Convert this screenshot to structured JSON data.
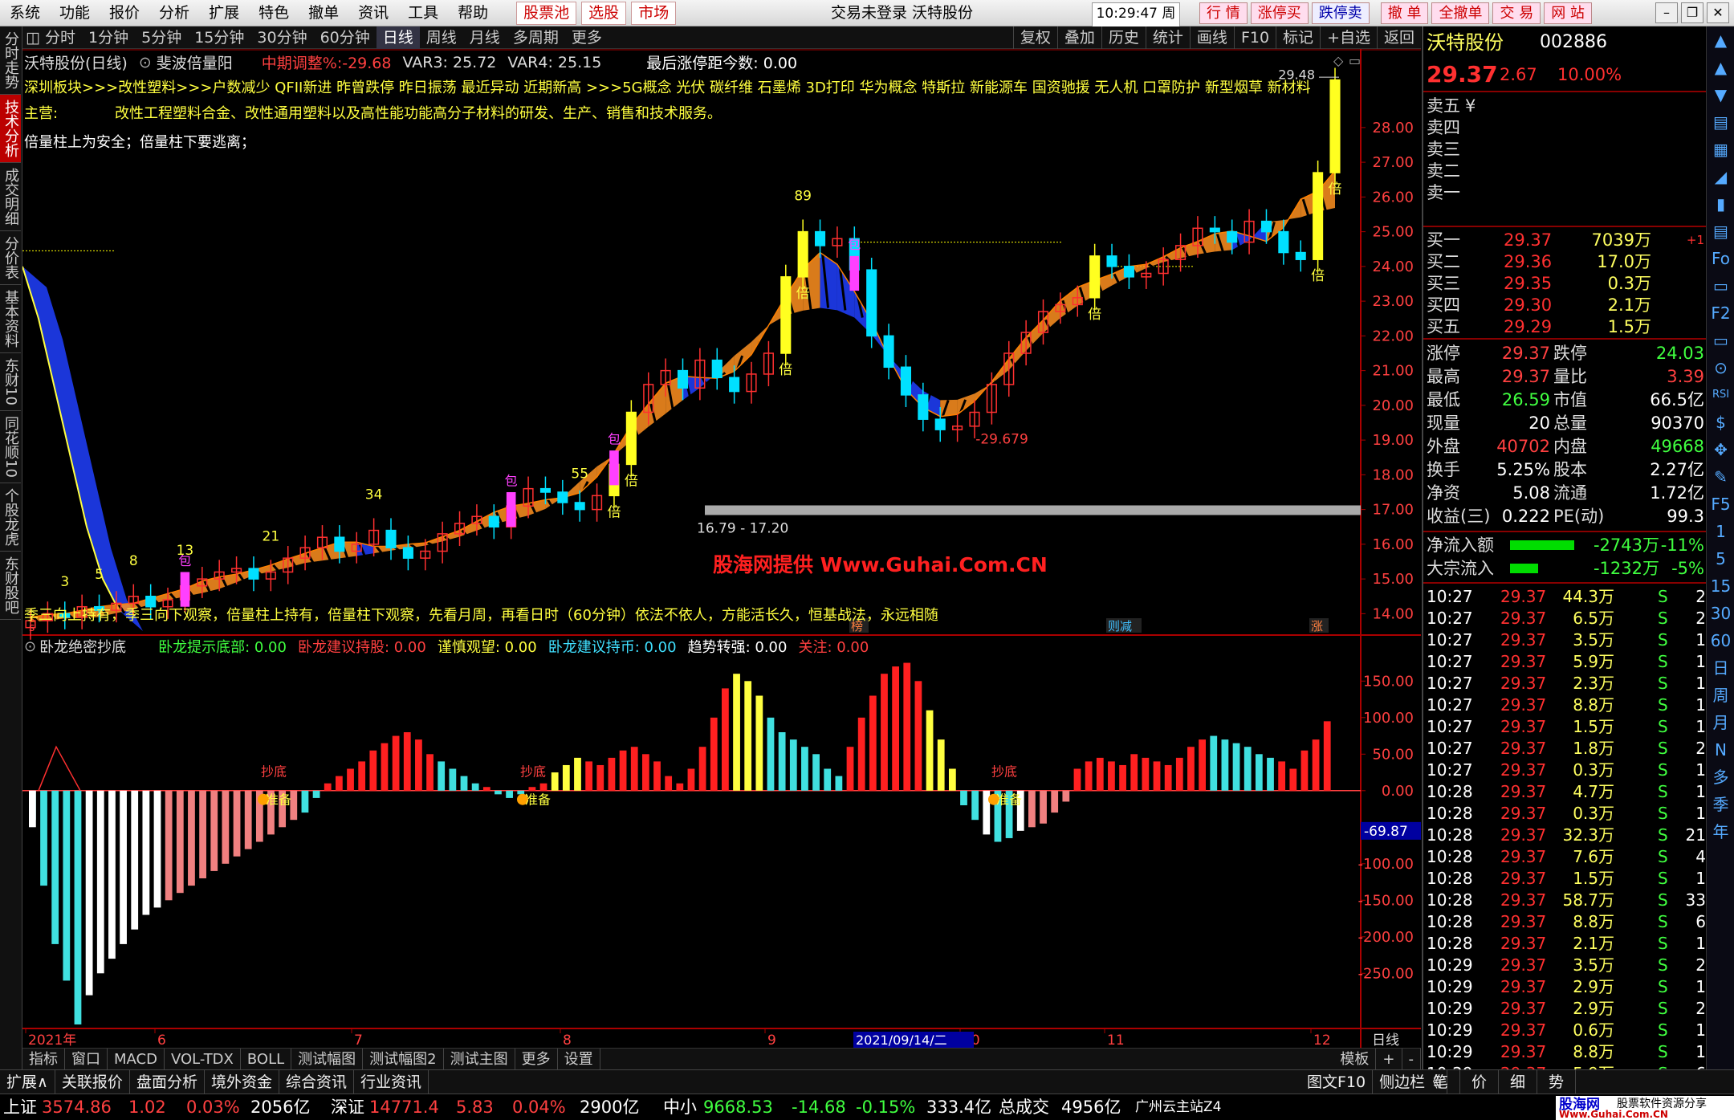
{
  "menubar": {
    "items": [
      "系统",
      "功能",
      "报价",
      "分析",
      "扩展",
      "特色",
      "撤单",
      "资讯",
      "工具",
      "帮助"
    ],
    "red_items": [
      "股票池",
      "选股",
      "市场"
    ],
    "center_title": "交易未登录  沃特股份",
    "time": "10:29:47 周五",
    "right_buttons": [
      "行 情",
      "涨停买",
      "跌停卖",
      "撤 单",
      "全撤单",
      "交 易",
      "网 站"
    ]
  },
  "leftbar": [
    "分时走势",
    "技术分析",
    "成交明细",
    "分价表",
    "基本资料",
    "东财10",
    "同花顺10",
    "个股龙虎",
    "东财股吧"
  ],
  "periodbar": {
    "items": [
      "分时",
      "1分钟",
      "5分钟",
      "15分钟",
      "30分钟",
      "60分钟",
      "日线",
      "周线",
      "月线",
      "多周期",
      "更多"
    ],
    "active": "日线",
    "right": [
      "复权",
      "叠加",
      "历史",
      "统计",
      "画线",
      "F10",
      "标记",
      "+自选",
      "返回"
    ]
  },
  "main_chart": {
    "stock_label": "沃特股份(日线)",
    "indicator_name": "斐波倍量阳",
    "indicator_values": [
      {
        "text": "中期调整%:-29.68",
        "color": "#ff4040"
      },
      {
        "text": "VAR3: 25.72",
        "color": "#dddddd"
      },
      {
        "text": "VAR4: 25.15",
        "color": "#dddddd"
      },
      {
        "text": "最后涨停距今数: 0.00",
        "color": "#ffffff"
      }
    ],
    "concept_line": "深圳板块>>>改性塑料>>>户数减少 QFII新进 昨曾跌停 昨日振荡 最近异动 近期新高 >>>5G概念 光伏 碳纤维 石墨烯 3D打印 华为概念 特斯拉 新能源车 国资驰援 无人机 口罩防护 新型烟草 新材料",
    "business_label": "主营:",
    "business_text": "改性工程塑料合金、改性通用塑料以及高性能功能高分子材料的研发、生产、销售和技术服务。",
    "slogan": "倍量柱上为安全；倍量柱下要逃离；",
    "bottom_text": "季三向上持有，季三向下观察，倍量柱上持有，倍量柱下观察，先看月周，再看日时（60分钟）依法不依人，方能活长久，恒基战法，永远相随",
    "watermark": "股海网提供 Www.Guhai.Com.CN",
    "support_band": "16.79 - 17.20",
    "high_label": "29.48",
    "low_label": "-29.679",
    "y_ticks": [
      "28.00",
      "27.00",
      "26.00",
      "25.00",
      "24.00",
      "23.00",
      "22.00",
      "21.00",
      "20.00",
      "19.00",
      "18.00",
      "17.00",
      "16.00",
      "15.00",
      "14.00"
    ],
    "number_labels": [
      "3",
      "5",
      "8",
      "13",
      "21",
      "34",
      "55",
      "89"
    ],
    "bei_label": "倍",
    "bao_label": "包",
    "markers": [
      {
        "text": "榜",
        "color": "#ff8040"
      },
      {
        "text": "则减",
        "color": "#40c0ff"
      },
      {
        "text": "涨",
        "color": "#ff8040"
      }
    ]
  },
  "sub_chart": {
    "name": "卧龙绝密抄底",
    "values": [
      {
        "text": "卧龙提示底部: 0.00",
        "color": "#40ff40"
      },
      {
        "text": "卧龙建议持股: 0.00",
        "color": "#ff4040"
      },
      {
        "text": "谨慎观望: 0.00",
        "color": "#ffff40"
      },
      {
        "text": "卧龙建议持币: 0.00",
        "color": "#40e0ff"
      },
      {
        "text": "趋势转强: 0.00",
        "color": "#ffffff"
      },
      {
        "text": "关注: 0.00",
        "color": "#ff4040"
      }
    ],
    "y_ticks": [
      "150.00",
      "100.00",
      "50.00",
      "0.00",
      "-100.00",
      "-150.00",
      "-200.00",
      "-250.00"
    ],
    "current_value": "-69.87",
    "chaodi_label": "抄底",
    "zhunbei_label": "准备"
  },
  "x_axis": {
    "labels": [
      "2021年",
      "6",
      "7",
      "8",
      "9",
      "10",
      "11",
      "12"
    ],
    "cursor_date": "2021/09/14/二",
    "right_label": "日线"
  },
  "bottom_tabs": [
    "指标",
    "窗口",
    "MACD",
    "VOL-TDX",
    "BOLL",
    "测试幅图",
    "测试幅图2",
    "测试主图",
    "更多",
    "设置"
  ],
  "bottom_tabs_right": [
    "模板",
    "+",
    "-"
  ],
  "func_bar": [
    "扩展∧",
    "关联报价",
    "盘面分析",
    "境外资金",
    "综合资讯",
    "行业资讯"
  ],
  "func_bar_right": [
    "图文F10",
    "侧边栏《"
  ],
  "func_bar_right_tabs": [
    "笔",
    "价",
    "细",
    "势"
  ],
  "quote": {
    "name": "沃特股份",
    "code": "002886",
    "price": "29.37",
    "change": "2.67",
    "pct": "10.00%",
    "sells": [
      {
        "label": "卖五",
        "p": "",
        "v": ""
      },
      {
        "label": "卖四",
        "p": "",
        "v": ""
      },
      {
        "label": "卖三",
        "p": "",
        "v": ""
      },
      {
        "label": "卖二",
        "p": "",
        "v": ""
      },
      {
        "label": "卖一",
        "p": "",
        "v": ""
      }
    ],
    "sell5_mark": "¥",
    "buys": [
      {
        "label": "买一",
        "p": "29.37",
        "v": "7039万",
        "d": "+1"
      },
      {
        "label": "买二",
        "p": "29.36",
        "v": "17.0万",
        "d": ""
      },
      {
        "label": "买三",
        "p": "29.35",
        "v": "0.3万",
        "d": ""
      },
      {
        "label": "买四",
        "p": "29.30",
        "v": "2.1万",
        "d": ""
      },
      {
        "label": "买五",
        "p": "29.29",
        "v": "1.5万",
        "d": ""
      }
    ],
    "stats": [
      {
        "l1": "涨停",
        "v1": "29.37",
        "c1": "#ff4040",
        "l2": "跌停",
        "v2": "24.03",
        "c2": "#40ff40"
      },
      {
        "l1": "最高",
        "v1": "29.37",
        "c1": "#ff4040",
        "l2": "量比",
        "v2": "3.39",
        "c2": "#ff4040"
      },
      {
        "l1": "最低",
        "v1": "26.59",
        "c1": "#40ff40",
        "l2": "市值",
        "v2": "66.5亿",
        "c2": "#ffffff"
      },
      {
        "l1": "现量",
        "v1": "20",
        "c1": "#ffffff",
        "l2": "总量",
        "v2": "90370",
        "c2": "#ffffff"
      },
      {
        "l1": "外盘",
        "v1": "40702",
        "c1": "#ff4040",
        "l2": "内盘",
        "v2": "49668",
        "c2": "#40ff40"
      },
      {
        "l1": "换手",
        "v1": "5.25%",
        "c1": "#ffffff",
        "l2": "股本",
        "v2": "2.27亿",
        "c2": "#ffffff"
      },
      {
        "l1": "净资",
        "v1": "5.08",
        "c1": "#ffffff",
        "l2": "流通",
        "v2": "1.72亿",
        "c2": "#ffffff"
      },
      {
        "l1": "收益(三)",
        "v1": "0.222",
        "c1": "#ffffff",
        "l2": "PE(动)",
        "v2": "99.3",
        "c2": "#ffffff"
      }
    ],
    "flows": [
      {
        "label": "净流入额",
        "v": "-2743万",
        "p": "-11%",
        "bar": 0.8
      },
      {
        "label": "大宗流入",
        "v": "-1232万",
        "p": "-5%",
        "bar": 0.35
      }
    ],
    "ticks": [
      {
        "t": "10:27",
        "p": "29.37",
        "v": "44.3万",
        "s": "S",
        "n": "2"
      },
      {
        "t": "10:27",
        "p": "29.37",
        "v": "6.5万",
        "s": "S",
        "n": "2"
      },
      {
        "t": "10:27",
        "p": "29.37",
        "v": "3.5万",
        "s": "S",
        "n": "1"
      },
      {
        "t": "10:27",
        "p": "29.37",
        "v": "5.9万",
        "s": "S",
        "n": "1"
      },
      {
        "t": "10:27",
        "p": "29.37",
        "v": "2.3万",
        "s": "S",
        "n": "1"
      },
      {
        "t": "10:27",
        "p": "29.37",
        "v": "8.8万",
        "s": "S",
        "n": "1"
      },
      {
        "t": "10:27",
        "p": "29.37",
        "v": "1.5万",
        "s": "S",
        "n": "1"
      },
      {
        "t": "10:27",
        "p": "29.37",
        "v": "1.8万",
        "s": "S",
        "n": "2"
      },
      {
        "t": "10:27",
        "p": "29.37",
        "v": "0.3万",
        "s": "S",
        "n": "1"
      },
      {
        "t": "10:28",
        "p": "29.37",
        "v": "4.7万",
        "s": "S",
        "n": "1"
      },
      {
        "t": "10:28",
        "p": "29.37",
        "v": "0.3万",
        "s": "S",
        "n": "1"
      },
      {
        "t": "10:28",
        "p": "29.37",
        "v": "32.3万",
        "s": "S",
        "n": "21"
      },
      {
        "t": "10:28",
        "p": "29.37",
        "v": "7.6万",
        "s": "S",
        "n": "4"
      },
      {
        "t": "10:28",
        "p": "29.37",
        "v": "1.5万",
        "s": "S",
        "n": "1"
      },
      {
        "t": "10:28",
        "p": "29.37",
        "v": "58.7万",
        "s": "S",
        "n": "33"
      },
      {
        "t": "10:28",
        "p": "29.37",
        "v": "8.8万",
        "s": "S",
        "n": "6"
      },
      {
        "t": "10:28",
        "p": "29.37",
        "v": "2.1万",
        "s": "S",
        "n": "1"
      },
      {
        "t": "10:29",
        "p": "29.37",
        "v": "3.5万",
        "s": "S",
        "n": "2"
      },
      {
        "t": "10:29",
        "p": "29.37",
        "v": "2.9万",
        "s": "S",
        "n": "1"
      },
      {
        "t": "10:29",
        "p": "29.37",
        "v": "2.9万",
        "s": "S",
        "n": "2"
      },
      {
        "t": "10:29",
        "p": "29.37",
        "v": "0.6万",
        "s": "S",
        "n": "1"
      },
      {
        "t": "10:29",
        "p": "29.37",
        "v": "8.8万",
        "s": "S",
        "n": "1"
      },
      {
        "t": "10:29",
        "p": "29.37",
        "v": "5.9万",
        "s": "S",
        "n": "6"
      }
    ]
  },
  "iconbar": [
    "▲",
    "▲",
    "▼",
    "▤",
    "▦",
    "◢",
    "▮",
    "▤",
    "Fo",
    "▭",
    "F2",
    "▭",
    "⊙",
    "RSI",
    "$",
    "✥",
    "✎",
    "F5",
    "1",
    "5",
    "15",
    "30",
    "60",
    "日",
    "周",
    "月",
    "N",
    "多",
    "季",
    "年"
  ],
  "statusbar": {
    "items": [
      {
        "t": "上证",
        "c": "#ffffff"
      },
      {
        "t": "3574.86",
        "c": "#ff4040"
      },
      {
        "t": "1.02",
        "c": "#ff4040"
      },
      {
        "t": "0.03%",
        "c": "#ff4040"
      },
      {
        "t": "2056亿",
        "c": "#ffffff"
      },
      {
        "t": "深证",
        "c": "#ffffff"
      },
      {
        "t": "14771.4",
        "c": "#ff4040"
      },
      {
        "t": "5.83",
        "c": "#ff4040"
      },
      {
        "t": "0.04%",
        "c": "#ff4040"
      },
      {
        "t": "2900亿",
        "c": "#ffffff"
      },
      {
        "t": "中小",
        "c": "#ffffff"
      },
      {
        "t": "9668.53",
        "c": "#40ff40"
      },
      {
        "t": "-14.68",
        "c": "#40ff40"
      },
      {
        "t": "-0.15%",
        "c": "#40ff40"
      },
      {
        "t": "333.4亿",
        "c": "#ffffff"
      },
      {
        "t": "总成交",
        "c": "#ffffff"
      },
      {
        "t": "4956亿",
        "c": "#ffffff"
      },
      {
        "t": "广州云主站Z4",
        "c": "#ffffff"
      }
    ],
    "logo": "股海网",
    "logo_sub": "股票软件资源分享",
    "logo_url": "Www.Guhai.Com.CN"
  },
  "chart_data": [
    {
      "type": "candlestick",
      "title": "沃特股份(日线)",
      "ylim": [
        13.5,
        29.8
      ],
      "close_path": [
        13.8,
        14.0,
        13.9,
        14.2,
        14.1,
        14.3,
        14.5,
        14.2,
        14.4,
        14.8,
        15.0,
        15.2,
        15.3,
        15.0,
        15.2,
        15.6,
        15.9,
        16.2,
        15.8,
        16.0,
        16.4,
        15.9,
        15.6,
        15.8,
        16.3,
        16.6,
        16.8,
        16.5,
        17.1,
        17.6,
        17.5,
        17.2,
        17.0,
        17.4,
        18.3,
        19.8,
        20.6,
        21.0,
        20.5,
        21.3,
        20.8,
        20.4,
        20.9,
        21.5,
        23.7,
        25.0,
        24.6,
        24.8,
        23.9,
        22.0,
        21.1,
        20.3,
        19.6,
        19.3,
        19.4,
        19.8,
        20.6,
        21.5,
        22.1,
        22.7,
        22.9,
        23.1,
        24.3,
        24.0,
        23.7,
        23.8,
        24.2,
        24.6,
        25.1,
        25.0,
        24.7,
        25.3,
        25.0,
        24.4,
        24.2,
        26.7,
        29.37
      ],
      "annotations": [
        "29.48",
        "-29.679",
        "16.79 - 17.20"
      ]
    },
    {
      "type": "bar",
      "title": "卧龙绝密抄底",
      "ylim": [
        -320,
        180
      ],
      "values": [
        -40,
        -130,
        -210,
        -260,
        -320,
        -280,
        -250,
        -230,
        -210,
        -190,
        -170,
        -160,
        -150,
        -140,
        -130,
        -120,
        -110,
        -100,
        -90,
        -80,
        -70,
        -60,
        -50,
        -40,
        -30,
        -10,
        10,
        20,
        30,
        40,
        55,
        65,
        75,
        80,
        70,
        50,
        40,
        30,
        20,
        10,
        5,
        -5,
        -10,
        -5,
        5,
        10,
        25,
        35,
        45,
        40,
        35,
        45,
        55,
        60,
        50,
        40,
        20,
        10,
        30,
        60,
        100,
        140,
        160,
        150,
        130,
        100,
        80,
        70,
        60,
        50,
        30,
        20,
        60,
        100,
        130,
        160,
        170,
        175,
        150,
        110,
        70,
        30,
        -20,
        -40,
        -60,
        -70,
        -65,
        -55,
        -50,
        -45,
        -30,
        -15,
        30,
        40,
        45,
        40,
        35,
        50,
        45,
        40,
        35,
        45,
        60,
        70,
        75,
        70,
        65,
        60,
        50,
        45,
        40,
        30,
        55,
        70,
        95
      ]
    }
  ]
}
